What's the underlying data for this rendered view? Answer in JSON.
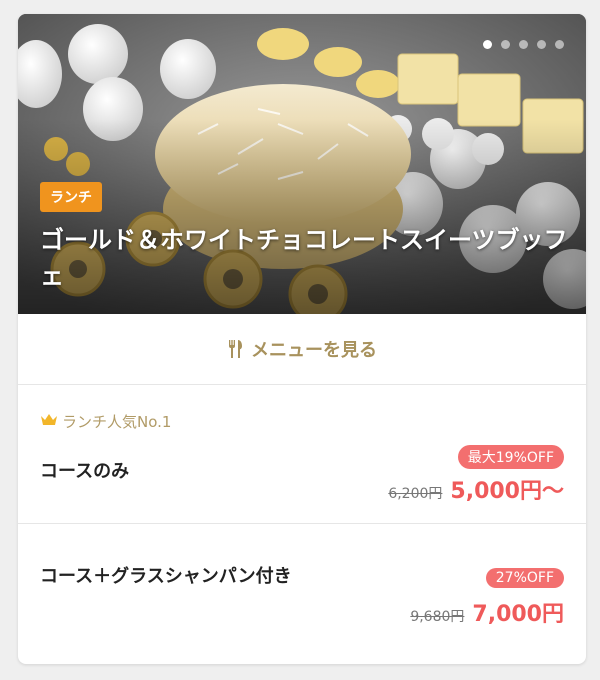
{
  "hero": {
    "badge": "ランチ",
    "title": "ゴールド＆ホワイトチョコレートスイーツブッフェ",
    "slide_count": 5,
    "active_slide": 1
  },
  "menu_link": {
    "label": "メニューを見る",
    "icon": "fork-knife-icon"
  },
  "plans": [
    {
      "rank_icon": "crown-icon",
      "rank_label": "ランチ人気No.1",
      "name": "コースのみ",
      "discount": "最大19%OFF",
      "original_price": "6,200円",
      "price": "5,000円〜"
    },
    {
      "name": "コース＋グラスシャンパン付き",
      "discount": "27%OFF",
      "original_price": "9,680円",
      "price": "7,000円"
    }
  ],
  "colors": {
    "badge": "#f0941e",
    "accent_gold": "#a8925d",
    "discount": "#f36f6f",
    "price": "#ef5a5a"
  }
}
